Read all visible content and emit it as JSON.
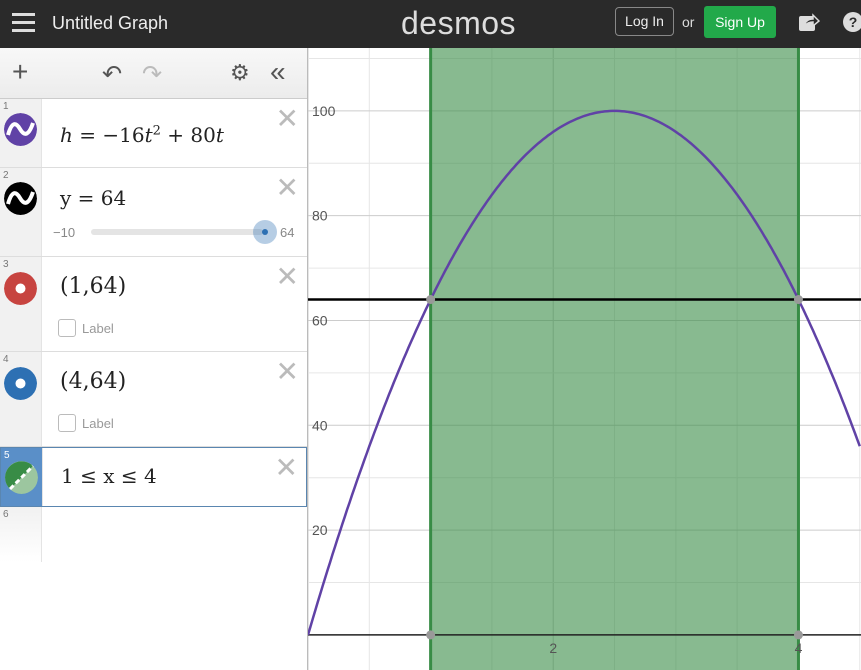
{
  "header": {
    "title": "Untitled Graph",
    "logo": "desmos",
    "login": "Log In",
    "or": "or",
    "signup": "Sign Up"
  },
  "toolbar": {
    "add": "+",
    "undo": "↶",
    "redo": "↷",
    "settings": "⚙",
    "collapse": "«"
  },
  "expressions": [
    {
      "n": "1",
      "color": "#6042a6",
      "latex_parts": [
        "h",
        "−16",
        "t",
        "2",
        "+ 80",
        "t"
      ]
    },
    {
      "n": "2",
      "color": "#000000",
      "text": "y = 64",
      "slider": {
        "min": "−10",
        "max": "64",
        "value": 64
      }
    },
    {
      "n": "3",
      "color": "#c74440",
      "text": "(1,64)",
      "label": "Label"
    },
    {
      "n": "4",
      "color": "#2d70b3",
      "text": "(4,64)",
      "label": "Label"
    },
    {
      "n": "5",
      "color": "#388c46",
      "text": "1 ≤ x ≤ 4"
    },
    {
      "n": "6"
    }
  ],
  "graph": {
    "x_range": [
      0,
      4.51
    ],
    "y_range": [
      -6.7,
      112
    ],
    "x_ticks": [
      "2",
      "4"
    ],
    "y_ticks": [
      "20",
      "40",
      "60",
      "80",
      "100"
    ],
    "curve": {
      "a": -16,
      "b": 80,
      "c": 0,
      "color": "#6042a6"
    },
    "line_y": 64,
    "region": {
      "x_min": 1,
      "x_max": 4,
      "color": "#388c46"
    },
    "points": [
      [
        1,
        64
      ],
      [
        4,
        64
      ],
      [
        1,
        0
      ],
      [
        4,
        0
      ]
    ]
  }
}
